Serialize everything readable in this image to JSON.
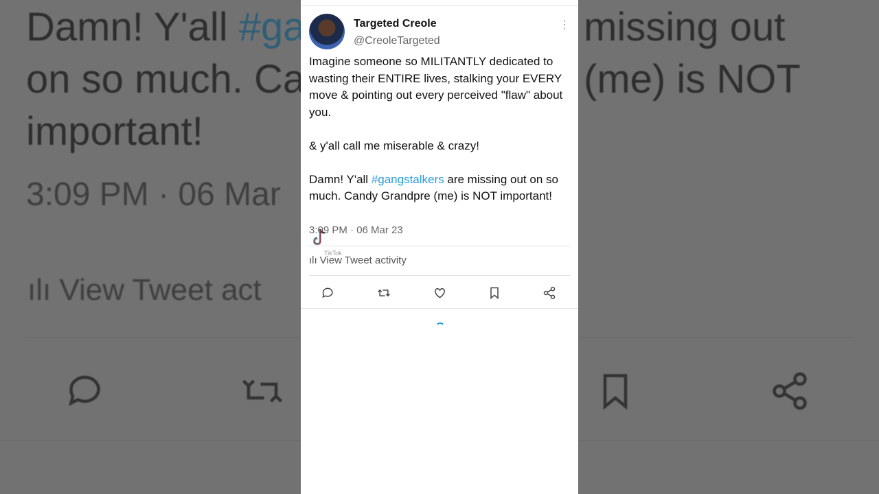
{
  "tweet": {
    "author_name": "Targeted Creole",
    "author_handle": "@CreoleTargeted",
    "more_label": "⋮",
    "paragraph1": "Imagine someone so MILITANTLY dedicated to wasting their ENTIRE lives, stalking your EVERY move & pointing out every perceived \"flaw\" about you.",
    "paragraph2": "& y'all call me miserable & crazy!",
    "paragraph3_prefix": "Damn! Y'all ",
    "paragraph3_hashtag": "#gangstalkers",
    "paragraph3_suffix": " are missing out on so much. Candy Grandpre (me) is NOT important!",
    "timestamp": "3:09 PM · 06 Mar 23",
    "activity_label": "View Tweet activity"
  },
  "background": {
    "line1_prefix": "Damn! Y'all ",
    "line1_tag": "#gar",
    "line1_right": "missing out",
    "line2_left": "on so much. Ca",
    "line2_right": "(me) is NOT",
    "line3": "important!",
    "time": "3:09 PM · 06 Mar",
    "activity": "View Tweet act"
  },
  "watermark": {
    "text": "TikTok"
  },
  "icons": [
    "reply-icon",
    "retweet-icon",
    "like-icon",
    "bookmark-icon",
    "share-icon"
  ],
  "colors": {
    "link": "#2a9bd8",
    "text": "#111111",
    "muted": "#666666"
  }
}
